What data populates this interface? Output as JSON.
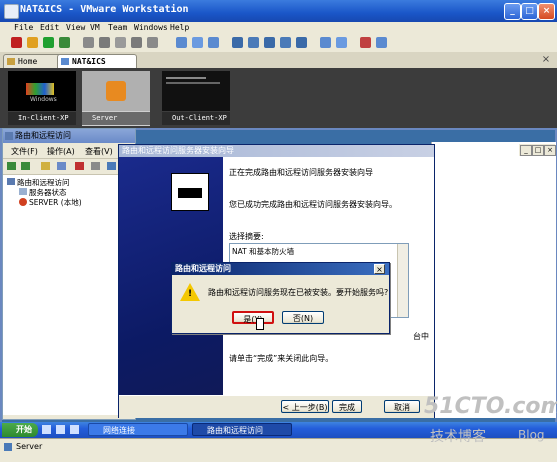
{
  "window": {
    "title": "NAT&ICS - VMware Workstation",
    "min": "_",
    "max": "□",
    "close": "×"
  },
  "menu": [
    "File",
    "Edit",
    "View",
    "VM",
    "Team",
    "Windows",
    "Help"
  ],
  "tabs": [
    {
      "label": "Home"
    },
    {
      "label": "NAT&ICS"
    }
  ],
  "tab_close": "×",
  "thumbnails": [
    {
      "label": "In-Client-XP"
    },
    {
      "label": "Server"
    },
    {
      "label": "Out-Client-XP"
    }
  ],
  "thumb_xp_logo": "Windows",
  "mmc": {
    "title": "路由和远程访问",
    "menu": [
      "文件(F)",
      "操作(A)",
      "查看(V)"
    ],
    "tree": [
      "路由和远程访问",
      "服务器状态",
      "SERVER (本地)"
    ]
  },
  "guest_ctrl": {
    "min": "_",
    "max": "□",
    "close": "×"
  },
  "wizard": {
    "title": "路由和远程访问服务器安装向导",
    "heading": "正在完成路由和远程访问服务器安装向导",
    "success": "您已成功完成路由和远程访问服务器安装向导。",
    "summary_label": "选择摘要:",
    "summary_text": "NAT 和基本防火墙",
    "behind_text": "台中",
    "finish_hint": "请单击“完成”来关闭此向导。",
    "back": "< 上一步(B)",
    "finish": "完成",
    "cancel": "取消"
  },
  "dialog": {
    "title": "路由和远程访问",
    "message": "路由和远程访问服务现在已被安装。要开始服务吗?",
    "yes": "是(Y)",
    "no": "否(N)",
    "close": "×",
    "warn_glyph": "!"
  },
  "taskbar": {
    "start": "开始",
    "items": [
      "网络连接",
      "路由和远程访问"
    ]
  },
  "status": {
    "vm": "Server"
  },
  "watermark": {
    "site": "51CTO.com",
    "sub": "技术博客",
    "blog": "Blog"
  }
}
